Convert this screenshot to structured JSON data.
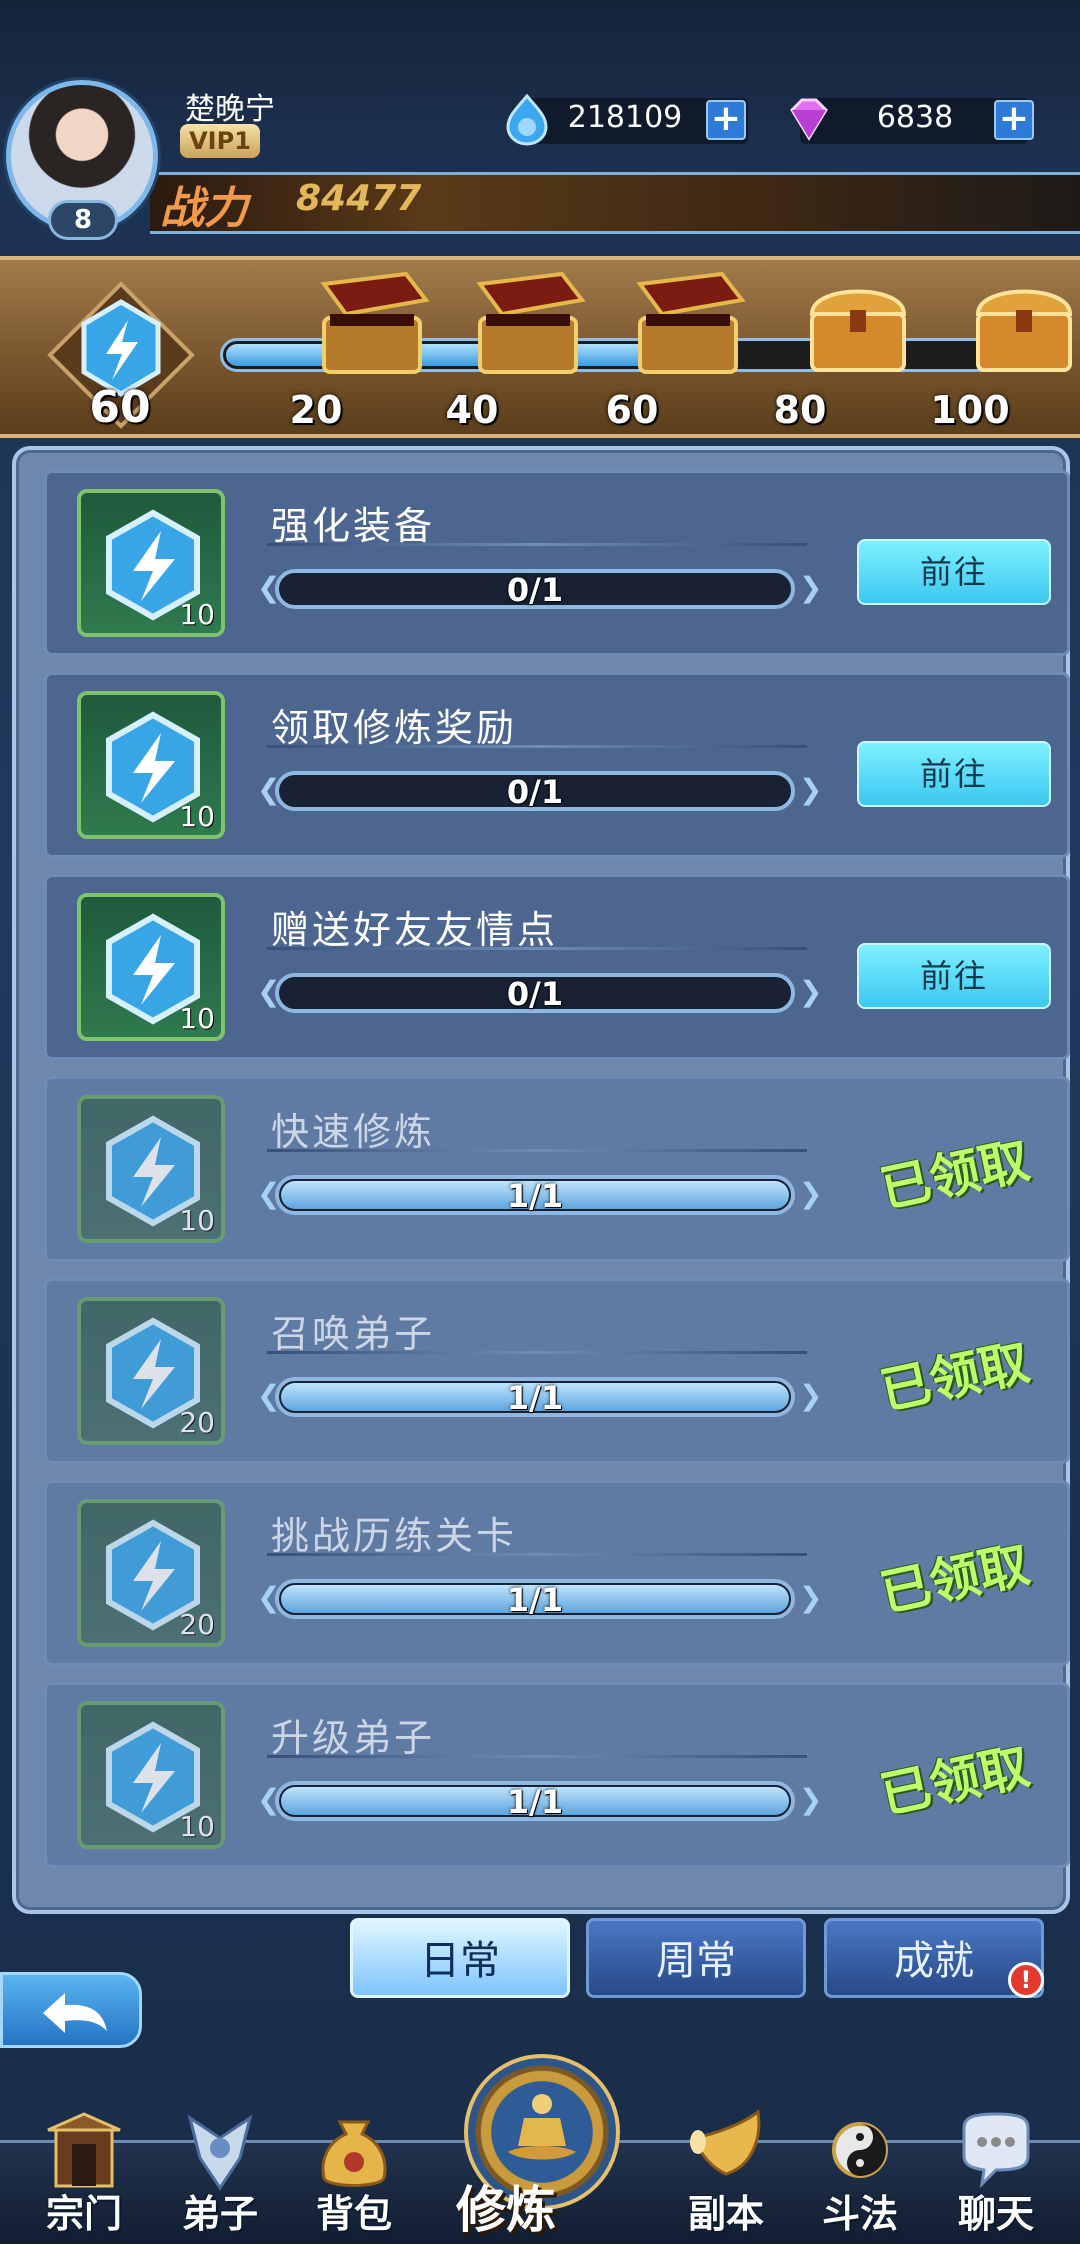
{
  "player": {
    "name": "楚晚宁",
    "vip": "VIP1",
    "level": "8",
    "power_label": "战力",
    "power_value": "84477"
  },
  "currencies": [
    {
      "name": "spirit-gem",
      "value": "218109",
      "color": "#3aa7f0"
    },
    {
      "name": "diamond",
      "value": "6838",
      "color": "#e26df0"
    }
  ],
  "activity": {
    "current": "60",
    "max": 100,
    "milestones": [
      {
        "label": "20",
        "state": "opened"
      },
      {
        "label": "40",
        "state": "opened"
      },
      {
        "label": "60",
        "state": "opened"
      },
      {
        "label": "80",
        "state": "closed"
      },
      {
        "label": "100",
        "state": "closed"
      }
    ]
  },
  "tasks": [
    {
      "title": "强化装备",
      "points": "10",
      "progress": "0/1",
      "action": "前往",
      "done": false
    },
    {
      "title": "领取修炼奖励",
      "points": "10",
      "progress": "0/1",
      "action": "前往",
      "done": false
    },
    {
      "title": "赠送好友友情点",
      "points": "10",
      "progress": "0/1",
      "action": "前往",
      "done": false
    },
    {
      "title": "快速修炼",
      "points": "10",
      "progress": "1/1",
      "action": "已领取",
      "done": true
    },
    {
      "title": "召唤弟子",
      "points": "20",
      "progress": "1/1",
      "action": "已领取",
      "done": true
    },
    {
      "title": "挑战历练关卡",
      "points": "20",
      "progress": "1/1",
      "action": "已领取",
      "done": true
    },
    {
      "title": "升级弟子",
      "points": "10",
      "progress": "1/1",
      "action": "已领取",
      "done": true
    }
  ],
  "tabs": [
    {
      "label": "日常",
      "active": true
    },
    {
      "label": "周常",
      "active": false
    },
    {
      "label": "成就",
      "active": false,
      "badge": "!"
    }
  ],
  "nav": [
    {
      "label": "宗门",
      "icon": "sect-gate-icon"
    },
    {
      "label": "弟子",
      "icon": "disciple-icon"
    },
    {
      "label": "背包",
      "icon": "bag-icon"
    },
    {
      "label": "修炼",
      "icon": "meditation-icon",
      "center": true
    },
    {
      "label": "副本",
      "icon": "horn-icon"
    },
    {
      "label": "斗法",
      "icon": "yin-yang-icon"
    },
    {
      "label": "聊天",
      "icon": "chat-icon"
    }
  ],
  "colors": {
    "accent": "#3cc8f0",
    "claimed": "#bdfc6a",
    "panel": "#6d87ad",
    "badge": "#e33a2f"
  }
}
